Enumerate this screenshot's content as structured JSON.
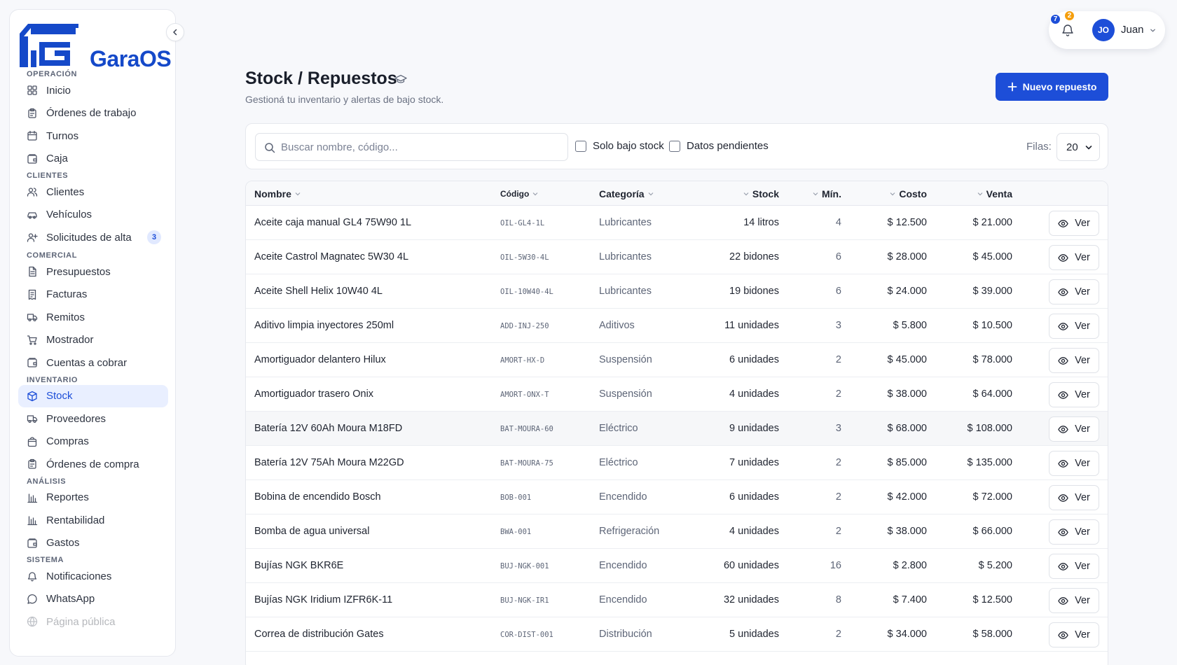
{
  "app": {
    "name": "GaraOS"
  },
  "sidebar": {
    "sections": [
      {
        "label": "OPERACIÓN",
        "items": [
          {
            "label": "Inicio",
            "icon": "grid-icon"
          },
          {
            "label": "Órdenes de trabajo",
            "icon": "clipboard-icon"
          },
          {
            "label": "Turnos",
            "icon": "calendar-icon"
          },
          {
            "label": "Caja",
            "icon": "wallet-icon"
          }
        ]
      },
      {
        "label": "CLIENTES",
        "items": [
          {
            "label": "Clientes",
            "icon": "users-icon"
          },
          {
            "label": "Vehículos",
            "icon": "car-icon"
          },
          {
            "label": "Solicitudes de alta",
            "icon": "user-plus-icon",
            "badge": "3"
          }
        ]
      },
      {
        "label": "COMERCIAL",
        "items": [
          {
            "label": "Presupuestos",
            "icon": "file-text-icon"
          },
          {
            "label": "Facturas",
            "icon": "receipt-icon"
          },
          {
            "label": "Remitos",
            "icon": "truck-icon"
          },
          {
            "label": "Mostrador",
            "icon": "cart-icon"
          },
          {
            "label": "Cuentas a cobrar",
            "icon": "wallet-icon"
          }
        ]
      },
      {
        "label": "INVENTARIO",
        "items": [
          {
            "label": "Stock",
            "icon": "box-icon",
            "active": true
          },
          {
            "label": "Proveedores",
            "icon": "truck-icon"
          },
          {
            "label": "Compras",
            "icon": "shopping-bag-icon"
          },
          {
            "label": "Órdenes de compra",
            "icon": "clipboard-icon"
          }
        ]
      },
      {
        "label": "ANÁLISIS",
        "items": [
          {
            "label": "Reportes",
            "icon": "bar-chart-icon"
          },
          {
            "label": "Rentabilidad",
            "icon": "bar-chart-icon"
          },
          {
            "label": "Gastos",
            "icon": "wallet-icon"
          }
        ]
      },
      {
        "label": "SISTEMA",
        "items": [
          {
            "label": "Notificaciones",
            "icon": "bell-icon"
          },
          {
            "label": "WhatsApp",
            "icon": "message-circle-icon"
          },
          {
            "label": "Página pública",
            "icon": "globe-icon"
          }
        ]
      }
    ]
  },
  "user": {
    "initials": "JO",
    "name": "Juan",
    "notif_count_blue": "7",
    "notif_count_orange": "2"
  },
  "header": {
    "title": "Stock / Repuestos",
    "subtitle": "Gestioná tu inventario y alertas de bajo stock.",
    "new_button": "Nuevo repuesto"
  },
  "filters": {
    "search_placeholder": "Buscar nombre, código...",
    "low_stock_label": "Solo bajo stock",
    "pending_label": "Datos pendientes",
    "rows_label": "Filas:",
    "rows_value": "20"
  },
  "table": {
    "columns": {
      "name": "Nombre",
      "code": "Código",
      "category": "Categoría",
      "stock": "Stock",
      "min": "Mín.",
      "cost": "Costo",
      "sale": "Venta"
    },
    "view_label": "Ver",
    "rows": [
      {
        "name": "Aceite caja manual GL4 75W90 1L",
        "code": "OIL-GL4-1L",
        "category": "Lubricantes",
        "stock": "14 litros",
        "min": "4",
        "cost": "$ 12.500",
        "sale": "$ 21.000"
      },
      {
        "name": "Aceite Castrol Magnatec 5W30 4L",
        "code": "OIL-5W30-4L",
        "category": "Lubricantes",
        "stock": "22 bidones",
        "min": "6",
        "cost": "$ 28.000",
        "sale": "$ 45.000"
      },
      {
        "name": "Aceite Shell Helix 10W40 4L",
        "code": "OIL-10W40-4L",
        "category": "Lubricantes",
        "stock": "19 bidones",
        "min": "6",
        "cost": "$ 24.000",
        "sale": "$ 39.000"
      },
      {
        "name": "Aditivo limpia inyectores 250ml",
        "code": "ADD-INJ-250",
        "category": "Aditivos",
        "stock": "11 unidades",
        "min": "3",
        "cost": "$ 5.800",
        "sale": "$ 10.500"
      },
      {
        "name": "Amortiguador delantero Hilux",
        "code": "AMORT-HX-D",
        "category": "Suspensión",
        "stock": "6 unidades",
        "min": "2",
        "cost": "$ 45.000",
        "sale": "$ 78.000"
      },
      {
        "name": "Amortiguador trasero Onix",
        "code": "AMORT-ONX-T",
        "category": "Suspensión",
        "stock": "4 unidades",
        "min": "2",
        "cost": "$ 38.000",
        "sale": "$ 64.000"
      },
      {
        "name": "Batería 12V 60Ah Moura M18FD",
        "code": "BAT-MOURA-60",
        "category": "Eléctrico",
        "stock": "9 unidades",
        "min": "3",
        "cost": "$ 68.000",
        "sale": "$ 108.000",
        "highlight": true
      },
      {
        "name": "Batería 12V 75Ah Moura M22GD",
        "code": "BAT-MOURA-75",
        "category": "Eléctrico",
        "stock": "7 unidades",
        "min": "2",
        "cost": "$ 85.000",
        "sale": "$ 135.000"
      },
      {
        "name": "Bobina de encendido Bosch",
        "code": "BOB-001",
        "category": "Encendido",
        "stock": "6 unidades",
        "min": "2",
        "cost": "$ 42.000",
        "sale": "$ 72.000"
      },
      {
        "name": "Bomba de agua universal",
        "code": "BWA-001",
        "category": "Refrigeración",
        "stock": "4 unidades",
        "min": "2",
        "cost": "$ 38.000",
        "sale": "$ 66.000"
      },
      {
        "name": "Bujías NGK BKR6E",
        "code": "BUJ-NGK-001",
        "category": "Encendido",
        "stock": "60 unidades",
        "min": "16",
        "cost": "$ 2.800",
        "sale": "$ 5.200"
      },
      {
        "name": "Bujías NGK Iridium IZFR6K-11",
        "code": "BUJ-NGK-IR1",
        "category": "Encendido",
        "stock": "32 unidades",
        "min": "8",
        "cost": "$ 7.400",
        "sale": "$ 12.500"
      },
      {
        "name": "Correa de distribución Gates",
        "code": "COR-DIST-001",
        "category": "Distribución",
        "stock": "5 unidades",
        "min": "2",
        "cost": "$ 34.000",
        "sale": "$ 58.000"
      }
    ]
  },
  "colors": {
    "accent": "#1d4ed8",
    "active_bg": "#e9efff",
    "badge_orange": "#f59e0b"
  }
}
